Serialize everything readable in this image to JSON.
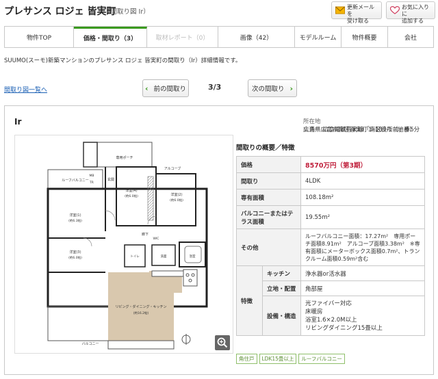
{
  "header": {
    "title": "プレサンス ロジェ 皆実町",
    "subtitle": "（間取り図 Ir）",
    "mail_btn": [
      "更新メールを",
      "受け取る"
    ],
    "fav_btn": [
      "お気に入りに",
      "追加する"
    ]
  },
  "tabs": [
    {
      "label": "物件TOP",
      "state": "normal"
    },
    {
      "label": "価格・間取り（3）",
      "state": "active"
    },
    {
      "label": "取材レポート（0）",
      "state": "disabled"
    },
    {
      "label": "画像（42）",
      "state": "normal"
    },
    {
      "label": "モデルルーム",
      "state": "normal"
    },
    {
      "label": "物件概要",
      "state": "normal"
    },
    {
      "label": "会社",
      "state": "normal"
    }
  ],
  "intro": "SUUMO(スーモ)新築マンションのプレサンス ロジェ 皆実町の間取り（Ir）詳細情報です。",
  "back_link": "間取り図一覧へ",
  "pager": {
    "prev": "前の間取り",
    "next": "次の間取り",
    "page": "3/3"
  },
  "plan": {
    "name": "Ir",
    "location_label": "所在地",
    "location": "広島県広島市南区皆実町１-183-1（地番）",
    "transit_label": "交通",
    "transit": "広島電鉄皆実線「南区役所前」歩5分"
  },
  "summary": {
    "title": "間取りの概要／特徴",
    "price_label": "価格",
    "price": "8570万円（第3期）",
    "layout_label": "間取り",
    "layout": "4LDK",
    "area_label": "専有面積",
    "area": "108.18m²",
    "balcony_label": "バルコニーまたはテラス面積",
    "balcony": "19.55m²",
    "other_label": "その他",
    "other": "ルーフバルコニー面積：17.27m²　専用ポーチ面積8.91m²　アルコーブ面積3.38m²　※専有面積にメーターボックス面積0.7m²、トランクルーム面積0.59m²含む",
    "feature_label": "特徴",
    "kitchen_label": "キッチン",
    "kitchen": "浄水器or活水器",
    "location_label": "立地・配置",
    "location": "角部屋",
    "equip_label": "設備・構造",
    "equip": [
      "光ファイバー対応",
      "床暖房",
      "浴室1.6×2.0M以上",
      "リビングダイニング15畳以上"
    ]
  },
  "tags": [
    "角住戸",
    "LDK15畳以上",
    "ルーフバルコニー"
  ],
  "floorplan_labels": {
    "roof_balcony": "ルーフバルコニー",
    "porch": "専用ポーチ",
    "alcove": "アルコーブ",
    "western_room_4": "洋室(4)",
    "western_room_2": "洋室(2)",
    "western_room_1": "洋室(1)",
    "western_room_3": "洋室(3)",
    "room_size_a": "(約6.0帖)",
    "room_size_b": "(約6.0帖)",
    "room_size_c": "(約6.3帖)",
    "room_size_d": "(約6.0帖)",
    "entrance": "玄関",
    "hallway": "廊下",
    "ldk": "リビング・ダイニング・キッチン",
    "ldk_size": "(約16.2帖)",
    "balcony": "バルコニー",
    "bath": "浴室",
    "wash": "洗面",
    "toilet": "トイレ",
    "wic": "WIC",
    "mb": "MB",
    "tr": "TR"
  }
}
